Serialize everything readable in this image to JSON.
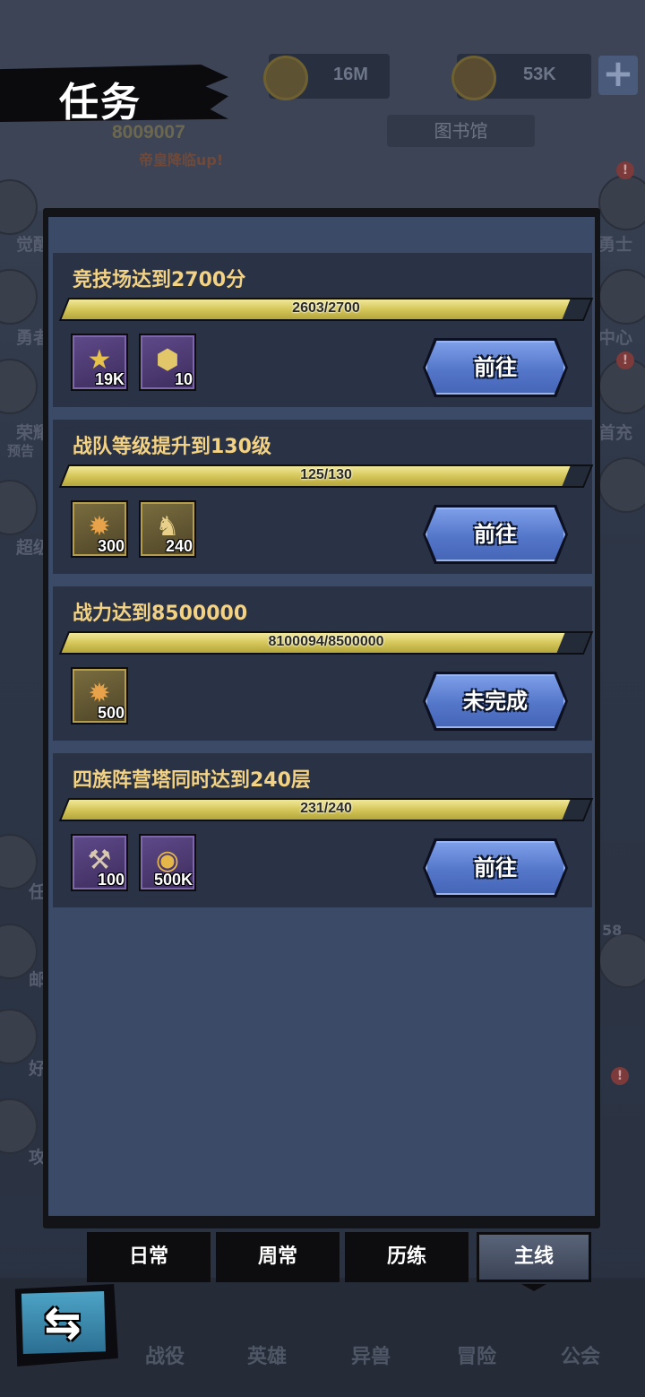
{
  "header": {
    "title": "任务"
  },
  "background": {
    "resource_1": "16M",
    "resource_2": "53K",
    "library_label": "图书馆",
    "score": "8009007",
    "promo": "帝皇降临up!",
    "side_labels_left": [
      "觉醒",
      "勇者",
      "荣耀",
      "预告",
      "超级",
      "任",
      "邮",
      "好",
      "攻"
    ],
    "side_labels_right": [
      "勇士",
      "中心",
      "首充"
    ],
    "chat_count": "58",
    "bottom_nav": [
      "战役",
      "英雄",
      "异兽",
      "冒险",
      "公会"
    ]
  },
  "tasks": [
    {
      "title": "竞技场达到2700分",
      "progress_text": "2603/2700",
      "progress": 0.964,
      "rewards": [
        {
          "icon": "medal-icon",
          "style": "purple",
          "count": "19K"
        },
        {
          "icon": "hero-token-icon",
          "style": "purple",
          "count": "10"
        }
      ],
      "button": "前往"
    },
    {
      "title": "战队等级提升到130级",
      "progress_text": "125/130",
      "progress": 0.962,
      "rewards": [
        {
          "icon": "exp-potion-icon",
          "style": "gold",
          "count": "300"
        },
        {
          "icon": "dragon-icon",
          "style": "gold",
          "count": "240"
        }
      ],
      "button": "前往"
    },
    {
      "title": "战力达到8500000",
      "progress_text": "8100094/8500000",
      "progress": 0.953,
      "rewards": [
        {
          "icon": "exp-potion-icon",
          "style": "gold",
          "count": "500"
        }
      ],
      "button": "未完成"
    },
    {
      "title": "四族阵营塔同时达到240层",
      "progress_text": "231/240",
      "progress": 0.9625,
      "rewards": [
        {
          "icon": "hammer-icon",
          "style": "purple",
          "count": "100"
        },
        {
          "icon": "gold-coin-icon",
          "style": "purple",
          "count": "500K"
        }
      ],
      "button": "前往"
    }
  ],
  "tabs": [
    {
      "label": "日常",
      "active": false
    },
    {
      "label": "周常",
      "active": false
    },
    {
      "label": "历练",
      "active": false
    },
    {
      "label": "主线",
      "active": true
    }
  ],
  "icons": {
    "back": "back-arrow-icon",
    "plus": "plus-icon"
  },
  "colors": {
    "task_title": "#f3d283",
    "progress_fill": "#d4c659",
    "button_blue": "#5476c9",
    "panel_bg": "#3b4a66",
    "card_bg": "#2a3246"
  }
}
